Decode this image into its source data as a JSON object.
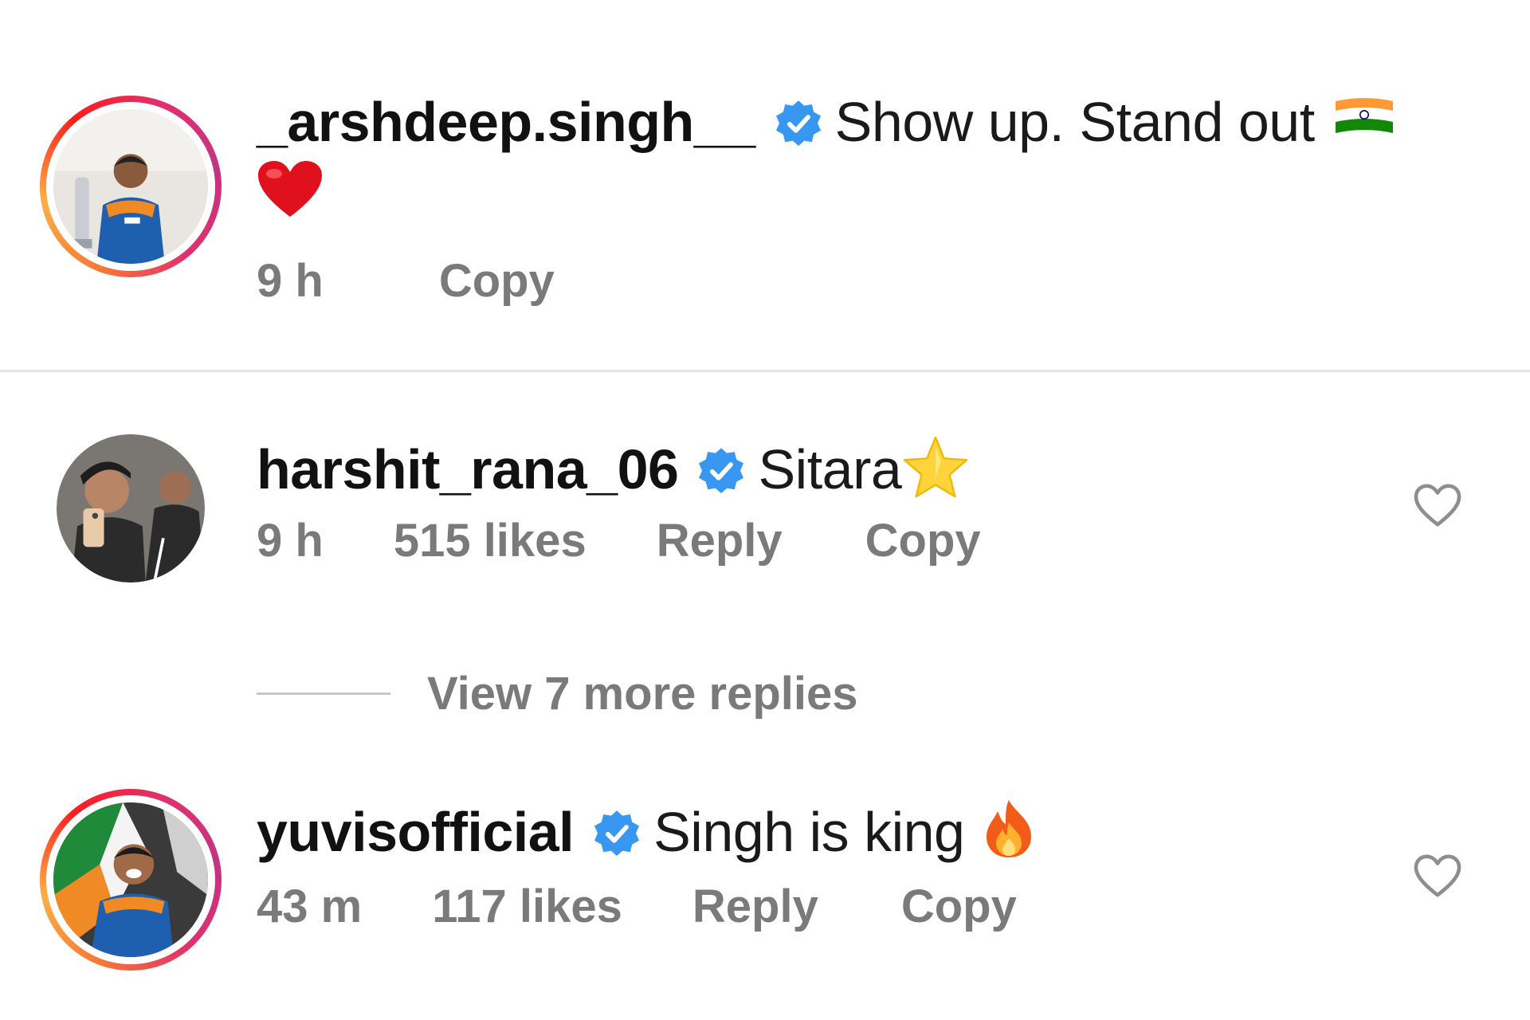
{
  "comments": [
    {
      "username": "_arshdeep.singh__",
      "verified": true,
      "text": "Show up. Stand out",
      "emojis": [
        "india-flag",
        "red-heart"
      ],
      "time": "9 h",
      "likes": null,
      "actions": {
        "copy": "Copy"
      },
      "avatar": "cricketer-holding-trophy-avatar",
      "story_ring": true
    },
    {
      "username": "harshit_rana_06",
      "verified": true,
      "text": "Sitara",
      "emojis": [
        "star"
      ],
      "time": "9 h",
      "likes": "515 likes",
      "actions": {
        "reply": "Reply",
        "copy": "Copy"
      },
      "avatar": "mirror-selfie-avatar",
      "story_ring": false
    },
    {
      "username": "yuvisofficial",
      "verified": true,
      "text": "Singh is king",
      "emojis": [
        "fire"
      ],
      "time": "43 m",
      "likes": "117 likes",
      "actions": {
        "reply": "Reply",
        "copy": "Copy"
      },
      "avatar": "cricketer-with-flag-avatar",
      "story_ring": true
    }
  ],
  "view_more": {
    "label": "View 7 more replies"
  },
  "colors": {
    "verified_blue": "#3897f0",
    "meta_gray": "#7a7a7a",
    "divider": "#e4e4e4"
  }
}
